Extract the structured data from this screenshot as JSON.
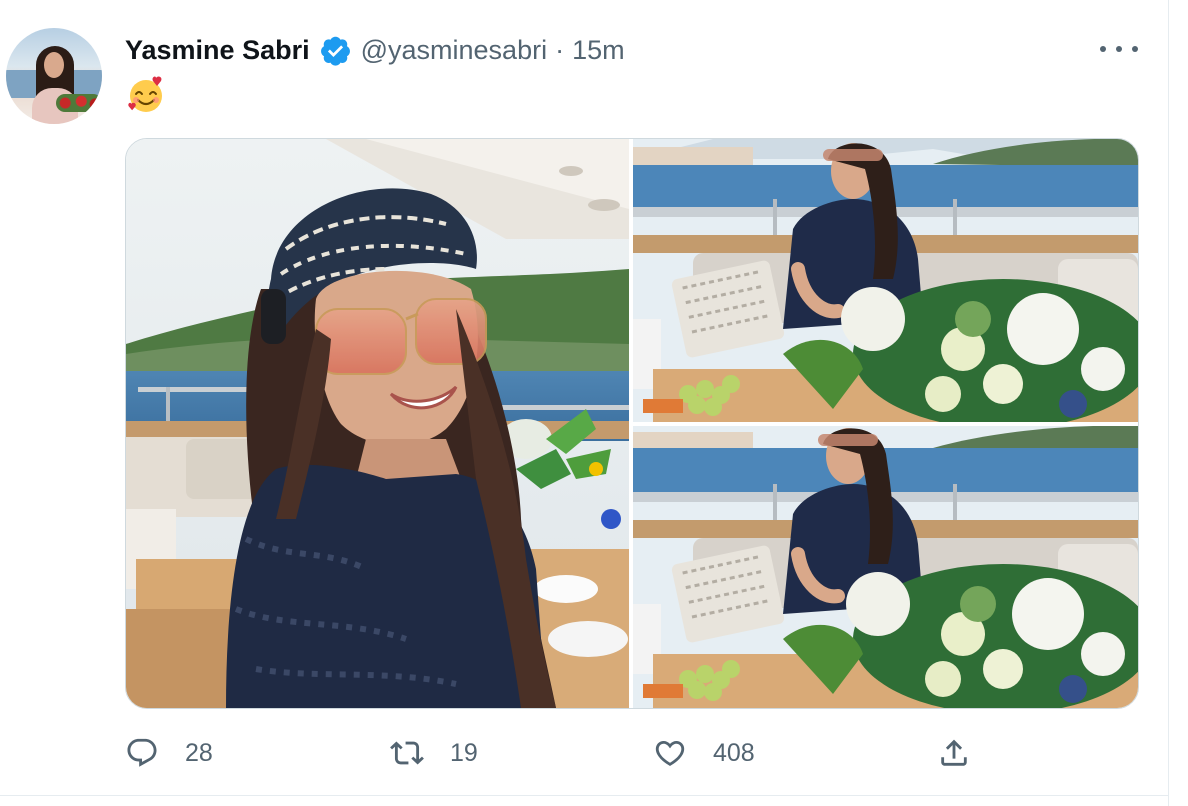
{
  "tweet": {
    "display_name": "Yasmine Sabri",
    "handle": "@yasminesabri",
    "separator": "·",
    "timestamp": "15m",
    "text": "🥰",
    "verified": true
  },
  "media": {
    "photo_count": 3,
    "photos": [
      {
        "name": "selfie-on-yacht"
      },
      {
        "name": "seated-with-flowers-top"
      },
      {
        "name": "seated-with-flowers-bottom"
      }
    ]
  },
  "actions": {
    "reply_count": "28",
    "retweet_count": "19",
    "like_count": "408"
  },
  "icons": {
    "verified": "verified-badge-icon",
    "more": "more-options-icon",
    "reply": "reply-icon",
    "retweet": "retweet-icon",
    "like": "like-icon",
    "share": "share-icon"
  },
  "colors": {
    "verified": "#1d9bf0",
    "secondary_text": "#536471",
    "primary_text": "#0f1419",
    "border": "#cfd9de"
  }
}
